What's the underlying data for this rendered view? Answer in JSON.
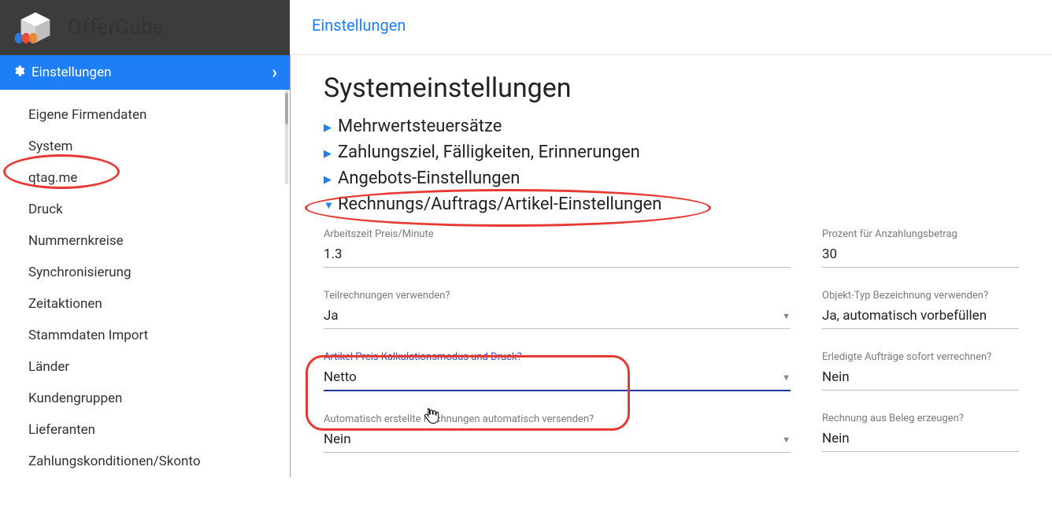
{
  "brand": "OfferCube",
  "breadcrumb": "Einstellungen",
  "sidebar": {
    "header": "Einstellungen",
    "items": [
      "Eigene Firmendaten",
      "System",
      "qtag.me",
      "Druck",
      "Nummernkreise",
      "Synchronisierung",
      "Zeitaktionen",
      "Stammdaten Import",
      "Länder",
      "Kundengruppen",
      "Lieferanten",
      "Zahlungskonditionen/Skonto"
    ]
  },
  "page": {
    "title": "Systemeinstellungen",
    "sections": [
      {
        "label": "Mehrwertsteuersätze",
        "expanded": false
      },
      {
        "label": "Zahlungsziel, Fälligkeiten, Erinnerungen",
        "expanded": false
      },
      {
        "label": "Angebots-Einstellungen",
        "expanded": false
      },
      {
        "label": "Rechnungs/Auftrags/Artikel-Einstellungen",
        "expanded": true
      }
    ],
    "fields": {
      "arbeitszeit": {
        "label": "Arbeitszeit Preis/Minute",
        "value": "1.3"
      },
      "prozent_anzahlung": {
        "label": "Prozent für Anzahlungsbetrag",
        "value": "30"
      },
      "teilrechnungen": {
        "label": "Teilrechnungen verwenden?",
        "value": "Ja"
      },
      "objekttyp": {
        "label": "Objekt-Typ Bezeichnung verwenden?",
        "value": "Ja, automatisch vorbefüllen"
      },
      "kalkmodus": {
        "label": "Artikel Preis Kalkulationsmodus und Druck?",
        "value": "Netto"
      },
      "erledigte": {
        "label": "Erledigte Aufträge sofort verrechnen?",
        "value": "Nein"
      },
      "auto_versenden": {
        "label": "Automatisch erstellte Rechnungen automatisch versenden?",
        "value": "Nein"
      },
      "rechnung_beleg": {
        "label": "Rechnung aus Beleg erzeugen?",
        "value": "Nein"
      }
    }
  }
}
